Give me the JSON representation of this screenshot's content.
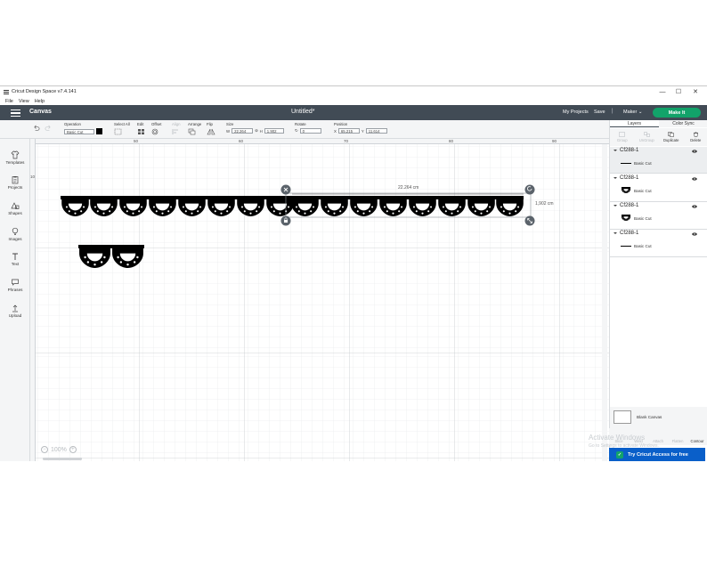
{
  "window": {
    "title": "Cricut Design Space  v7.4.141",
    "controls": [
      "—",
      "☐",
      "✕"
    ]
  },
  "menu": [
    "File",
    "View",
    "Help"
  ],
  "header": {
    "canvas_label": "Canvas",
    "doc_title": "Untitled*",
    "my_projects": "My Projects",
    "save": "Save",
    "separator": "|",
    "machine": "Maker",
    "make_it": "Make It",
    "accent": "#12a36a",
    "bg": "#414b55"
  },
  "toolbar": {
    "operation_label": "Operation",
    "operation_value": "Basic Cut",
    "select_all": "Select All",
    "edit": "Edit",
    "offset": "Offset",
    "align": "Align",
    "arrange": "Arrange",
    "flip": "Flip",
    "size": "Size",
    "w_label": "W",
    "w_value": "22.264",
    "h_label": "H",
    "h_value": "1.902",
    "rotate": "Rotate",
    "rotate_value": "0",
    "position": "Position",
    "x_label": "X",
    "x_value": "65.215",
    "y_label": "Y",
    "y_value": "11.614"
  },
  "leftnav": [
    {
      "label": "New",
      "icon": "plus-circle-icon"
    },
    {
      "label": "Templates",
      "icon": "shirt-icon"
    },
    {
      "label": "Projects",
      "icon": "clipboard-icon"
    },
    {
      "label": "Shapes",
      "icon": "shapes-icon"
    },
    {
      "label": "Images",
      "icon": "lightbulb-icon"
    },
    {
      "label": "Text",
      "icon": "text-icon"
    },
    {
      "label": "Phrases",
      "icon": "speech-bubble-icon"
    },
    {
      "label": "Upload",
      "icon": "upload-icon"
    }
  ],
  "rulers": {
    "top": [
      "50",
      "60",
      "70",
      "80",
      "90"
    ],
    "left": [
      "10",
      "",
      "",
      ""
    ]
  },
  "canvas": {
    "width_readout": "22.264 cm",
    "height_readout": "1,902 cm",
    "zoom": "100%"
  },
  "panel": {
    "tabs": [
      "Layers",
      "Color Sync"
    ],
    "tools": [
      "Group",
      "UnGroup",
      "Duplicate",
      "Delete"
    ],
    "layers": [
      {
        "name": "Cf288-1",
        "sub": "Basic Cut",
        "thumb": "line"
      },
      {
        "name": "Cf288-1",
        "sub": "Basic Cut",
        "thumb": "scallop"
      },
      {
        "name": "Cf288-1",
        "sub": "Basic Cut",
        "thumb": "scallop"
      },
      {
        "name": "Cf288-1",
        "sub": "Basic Cut",
        "thumb": "line"
      }
    ],
    "blank_canvas": "Blank Canvas",
    "bottom_tools": [
      "Slice",
      "Weld",
      "Attach",
      "Flatten",
      "Contour"
    ],
    "try_access": "Try Cricut Access for free"
  },
  "watermark": {
    "line1": "Activate Windows",
    "line2": "Go to Settings to activate Windows."
  }
}
